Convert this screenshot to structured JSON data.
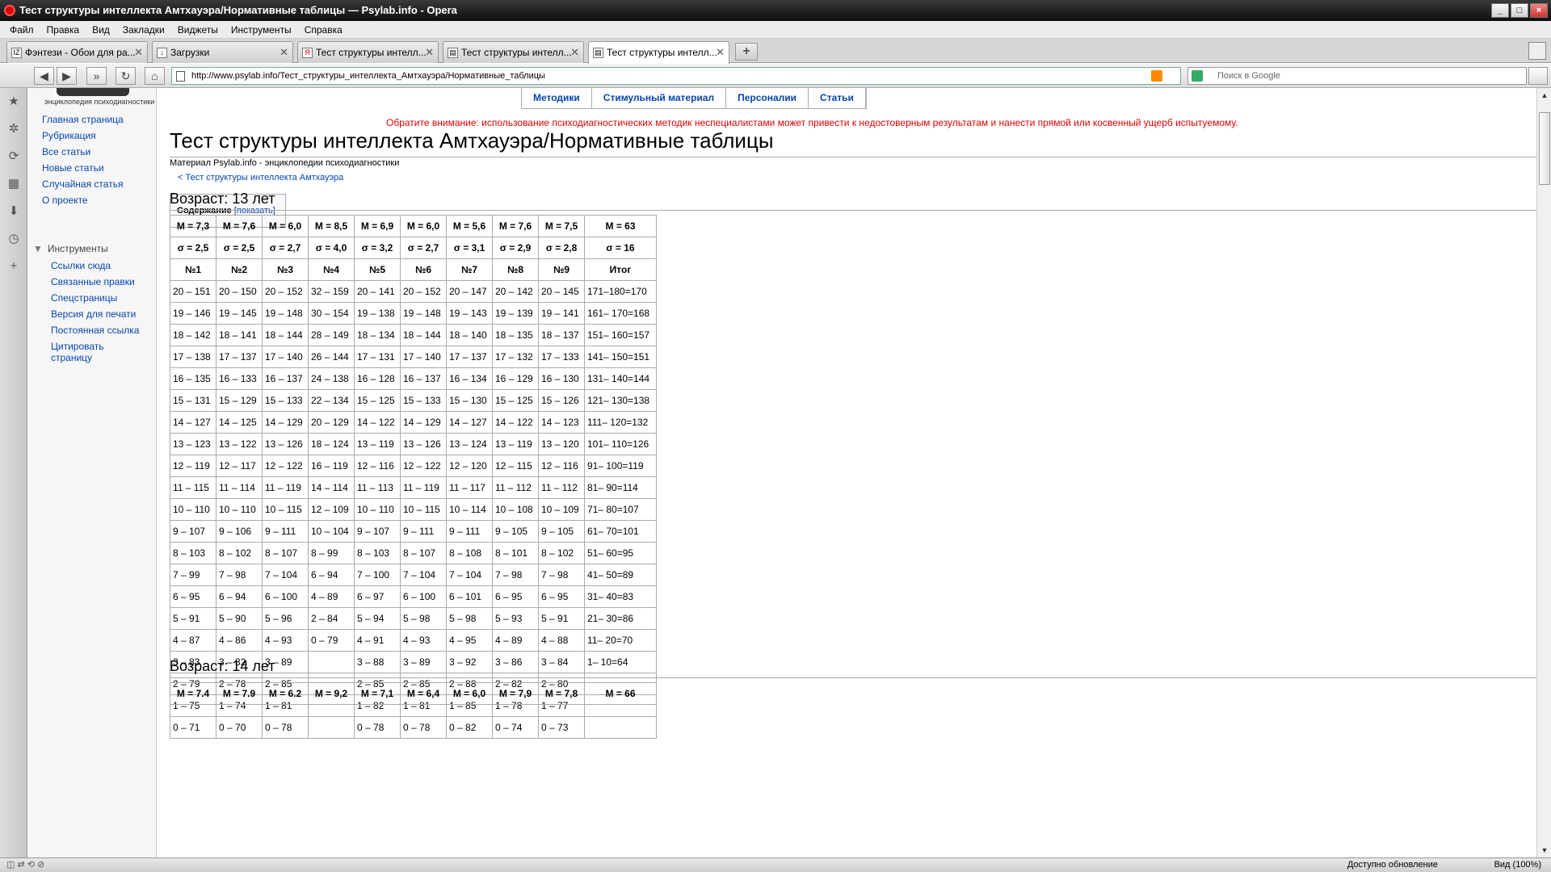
{
  "window": {
    "title": "Тест структуры интеллекта Амтхауэра/Нормативные таблицы — Psylab.info - Opera"
  },
  "menu": [
    "Файл",
    "Правка",
    "Вид",
    "Закладки",
    "Виджеты",
    "Инструменты",
    "Справка"
  ],
  "tabs": [
    {
      "label": "Фэнтези - Обои для ра...",
      "icon": "IZ"
    },
    {
      "label": "Загрузки",
      "icon": "↓"
    },
    {
      "label": "Тест структуры интелл...",
      "icon": "Я"
    },
    {
      "label": "Тест структуры интелл...",
      "icon": "▤"
    },
    {
      "label": "Тест структуры интелл...",
      "icon": "▤"
    }
  ],
  "address": {
    "url": "http://www.psylab.info/Тест_структуры_интеллекта_Амтхауэра/Нормативные_таблицы",
    "search_placeholder": "Поиск в Google"
  },
  "sidebar": {
    "logo_text": "энциклопедия психодиагностики",
    "main_links": [
      "Главная страница",
      "Рубрикация",
      "Все статьи",
      "Новые статьи",
      "Случайная статья",
      "О проекте"
    ],
    "tools_heading": "Инструменты",
    "tools_links": [
      "Ссылки сюда",
      "Связанные правки",
      "Спецстраницы",
      "Версия для печати",
      "Постоянная ссылка",
      "Цитировать страницу"
    ]
  },
  "topnav": [
    "Методики",
    "Стимульный материал",
    "Персоналии",
    "Статьи"
  ],
  "page": {
    "warning": "Обратите внимание: использование психодиагностических методик неспециалистами может привести к недостоверным результатам и нанести прямой или косвенный ущерб испытуемому.",
    "title": "Тест структуры интеллекта Амтхауэра/Нормативные таблицы",
    "material": "Материал Psylab.info - энциклопедии психодиагностики",
    "backlink": "< Тест структуры интеллекта Амтхауэра",
    "toc_label": "Содержание",
    "toc_toggle": "[показать]"
  },
  "age13": {
    "heading": "Возраст: 13 лет",
    "means": [
      "M = 7,3",
      "M = 7,6",
      "M = 6,0",
      "M = 8,5",
      "M = 6,9",
      "M = 6,0",
      "M = 5,6",
      "M = 7,6",
      "M = 7,5",
      "M = 63"
    ],
    "sigmas": [
      "σ = 2,5",
      "σ = 2,5",
      "σ = 2,7",
      "σ = 4,0",
      "σ = 3,2",
      "σ = 2,7",
      "σ = 3,1",
      "σ = 2,9",
      "σ = 2,8",
      "σ = 16"
    ],
    "cols": [
      "№1",
      "№2",
      "№3",
      "№4",
      "№5",
      "№6",
      "№7",
      "№8",
      "№9",
      "Итог"
    ],
    "rows": [
      [
        "20 – 151",
        "20 – 150",
        "20 – 152",
        "32 – 159",
        "20 – 141",
        "20 – 152",
        "20 – 147",
        "20 – 142",
        "20 – 145",
        "171–180=170"
      ],
      [
        "19 – 146",
        "19 – 145",
        "19 – 148",
        "30 – 154",
        "19 – 138",
        "19 – 148",
        "19 – 143",
        "19 – 139",
        "19 – 141",
        "161– 170=168"
      ],
      [
        "18 – 142",
        "18 – 141",
        "18 – 144",
        "28 – 149",
        "18 – 134",
        "18 – 144",
        "18 – 140",
        "18 – 135",
        "18 – 137",
        "151– 160=157"
      ],
      [
        "17 – 138",
        "17 – 137",
        "17 – 140",
        "26 – 144",
        "17 – 131",
        "17 – 140",
        "17 – 137",
        "17 – 132",
        "17 – 133",
        "141– 150=151"
      ],
      [
        "16 – 135",
        "16 – 133",
        "16 – 137",
        "24 – 138",
        "16 – 128",
        "16 – 137",
        "16 – 134",
        "16 – 129",
        "16 – 130",
        "131– 140=144"
      ],
      [
        "15 – 131",
        "15 – 129",
        "15 – 133",
        "22 – 134",
        "15 – 125",
        "15 – 133",
        "15 – 130",
        "15 – 125",
        "15 – 126",
        "121– 130=138"
      ],
      [
        "14 – 127",
        "14 – 125",
        "14 – 129",
        "20 – 129",
        "14 – 122",
        "14 – 129",
        "14 – 127",
        "14 – 122",
        "14 – 123",
        "111– 120=132"
      ],
      [
        "13 – 123",
        "13 – 122",
        "13 – 126",
        "18 – 124",
        "13 – 119",
        "13 – 126",
        "13 – 124",
        "13 – 119",
        "13 – 120",
        "101– 110=126"
      ],
      [
        "12 – 119",
        "12 – 117",
        "12 – 122",
        "16 – 119",
        "12 – 116",
        "12 – 122",
        "12 – 120",
        "12 – 115",
        "12 – 116",
        "91– 100=119"
      ],
      [
        "11 – 115",
        "11 – 114",
        "11 – 119",
        "14 – 114",
        "11 – 113",
        "11 – 119",
        "11 – 117",
        "11 – 112",
        "11 – 112",
        "81– 90=114"
      ],
      [
        "10 – 110",
        "10 – 110",
        "10 – 115",
        "12 – 109",
        "10 – 110",
        "10 – 115",
        "10 – 114",
        "10 – 108",
        "10 – 109",
        "71– 80=107"
      ],
      [
        "9 – 107",
        "9 – 106",
        "9 – 111",
        "10 – 104",
        "9 – 107",
        "9 – 111",
        "9 – 111",
        "9 – 105",
        "9 – 105",
        "61– 70=101"
      ],
      [
        "8 – 103",
        "8 – 102",
        "8 – 107",
        "8 – 99",
        "8 – 103",
        "8 – 107",
        "8 – 108",
        "8 – 101",
        "8 – 102",
        "51– 60=95"
      ],
      [
        "7 – 99",
        "7 – 98",
        "7 – 104",
        "6 – 94",
        "7 – 100",
        "7 – 104",
        "7 – 104",
        "7 – 98",
        "7 – 98",
        "41– 50=89"
      ],
      [
        "6 – 95",
        "6 – 94",
        "6 – 100",
        "4 – 89",
        "6 – 97",
        "6 – 100",
        "6 – 101",
        "6 – 95",
        "6 – 95",
        "31– 40=83"
      ],
      [
        "5 – 91",
        "5 – 90",
        "5 – 96",
        "2 – 84",
        "5 – 94",
        "5 – 98",
        "5 – 98",
        "5 – 93",
        "5 – 91",
        "21– 30=86"
      ],
      [
        "4 – 87",
        "4 – 86",
        "4 – 93",
        "0 – 79",
        "4 – 91",
        "4 – 93",
        "4 – 95",
        "4 – 89",
        "4 – 88",
        "11– 20=70"
      ],
      [
        "3 – 83",
        "3 – 82",
        "3 – 89",
        "",
        "3 – 88",
        "3 – 89",
        "3 – 92",
        "3 – 86",
        "3 – 84",
        "1– 10=64"
      ],
      [
        "2 – 79",
        "2 – 78",
        "2 – 85",
        "",
        "2 – 85",
        "2 – 85",
        "2 – 88",
        "2 – 82",
        "2 – 80",
        ""
      ],
      [
        "1 – 75",
        "1 – 74",
        "1 – 81",
        "",
        "1 – 82",
        "1 – 81",
        "1 – 85",
        "1 – 78",
        "1 – 77",
        ""
      ],
      [
        "0 – 71",
        "0 – 70",
        "0 – 78",
        "",
        "0 – 78",
        "0 – 78",
        "0 – 82",
        "0 – 74",
        "0 – 73",
        ""
      ]
    ]
  },
  "age14": {
    "heading": "Возраст: 14 лет",
    "means": [
      "M = 7.4",
      "M = 7.9",
      "M = 6.2",
      "M = 9,2",
      "M = 7,1",
      "M = 6,4",
      "M = 6,0",
      "M = 7,9",
      "M = 7,8",
      "M = 66"
    ]
  },
  "status": {
    "update": "Доступно обновление",
    "zoom": "Вид (100%)"
  }
}
